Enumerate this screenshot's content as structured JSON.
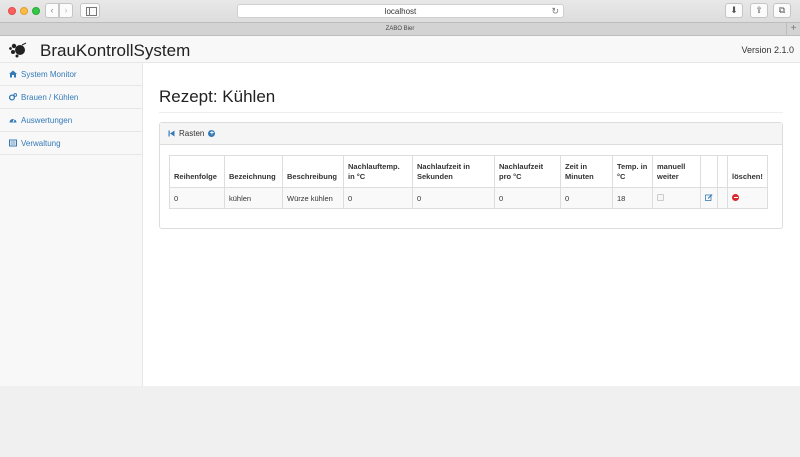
{
  "browser": {
    "url": "localhost",
    "tab_title": "ZABO Bier",
    "back_glyph": "‹",
    "forward_glyph": "›",
    "reload_glyph": "↻",
    "newtab_glyph": "+",
    "download_glyph": "⬇",
    "share_glyph": "⇪",
    "tabs_glyph": "⧉"
  },
  "header": {
    "brand": "BrauKontrollSystem",
    "version": "Version 2.1.0"
  },
  "sidebar": {
    "items": [
      {
        "label": "System Monitor",
        "icon": "home-icon"
      },
      {
        "label": "Brauen / Kühlen",
        "icon": "cogs-icon"
      },
      {
        "label": "Auswertungen",
        "icon": "dashboard-icon"
      },
      {
        "label": "Verwaltung",
        "icon": "list-icon"
      }
    ]
  },
  "main": {
    "title": "Rezept: Kühlen",
    "panel": {
      "link_label": "Rasten",
      "columns": [
        "Reihenfolge",
        "Bezeichnung",
        "Beschreibung",
        "Nachlauftemp. in °C",
        "Nachlaufzeit in Sekunden",
        "Nachlaufzeit pro °C",
        "Zeit in Minuten",
        "Temp. in °C",
        "manuell weiter",
        "",
        "",
        "löschen!"
      ],
      "rows": [
        [
          "0",
          "kühlen",
          "Würze kühlen",
          "0",
          "0",
          "0",
          "0",
          "18"
        ]
      ]
    }
  },
  "colors": {
    "link": "#337ab7",
    "delete": "#d9272e"
  }
}
